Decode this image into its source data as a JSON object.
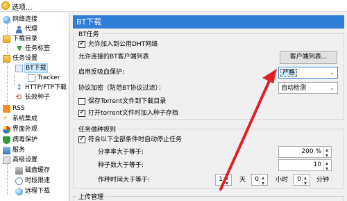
{
  "window": {
    "title": "选项..."
  },
  "sidebar": {
    "items": [
      {
        "label": "网络连接",
        "icon": "globe-icon"
      },
      {
        "label": "代理",
        "icon": "user-icon"
      },
      {
        "label": "下载目录",
        "icon": "folder-icon"
      },
      {
        "label": "任务标签",
        "icon": "arrow-down-icon"
      },
      {
        "label": "任务设置",
        "icon": "folder-icon"
      },
      {
        "label": "BT下载",
        "icon": "bt-icon"
      },
      {
        "label": "Tracker",
        "icon": "document-icon"
      },
      {
        "label": "HTTP/FTP下载",
        "icon": "arrows-icon"
      },
      {
        "label": "长效种子",
        "icon": "refresh-icon"
      },
      {
        "label": "RSS",
        "icon": "rss-icon"
      },
      {
        "label": "系统集成",
        "icon": "plug-icon"
      },
      {
        "label": "界面外观",
        "icon": "palette-icon"
      },
      {
        "label": "病毒保护",
        "icon": "shield-icon"
      },
      {
        "label": "服务",
        "icon": "services-icon"
      },
      {
        "label": "高级设置",
        "icon": "advanced-icon"
      },
      {
        "label": "磁盘缓存",
        "icon": "disk-icon"
      },
      {
        "label": "时段限速",
        "icon": "clock-icon"
      },
      {
        "label": "远程下载",
        "icon": "remote-icon"
      }
    ],
    "selected": "BT下载"
  },
  "main": {
    "header": "BT下载",
    "bt_task": {
      "title": "BT任务",
      "dht_label": "允许加入到公用DHT网络",
      "dht_checked": true,
      "allowed_clients_label": "允许连接的BT客户端列表",
      "client_list_button": "客户端列表...",
      "anti_leech_label": "启用反吸血保护:",
      "anti_leech_value": "严格",
      "encryption_label": "协议加密（防范BT协议过滤）：",
      "encryption_value": "自动检测",
      "save_torrent_label": "保存Torrent文件到下载目录",
      "save_torrent_checked": false,
      "add_seed_label": "打开torrent文件时加入种子存档",
      "add_seed_checked": true
    },
    "seeding_rules": {
      "title": "任务做种规则",
      "auto_stop_label": "符合以下全部条件时自动停止任务",
      "auto_stop_checked": true,
      "ratio_label": "分享率大于等于:",
      "ratio_value": "200 %",
      "seeds_label": "种子数大于等于:",
      "seeds_value": "10",
      "time_label": "作种时间大于等于:",
      "days_value": "1",
      "days_unit": "天",
      "hours_value": "0",
      "hours_unit": "小时",
      "minutes_value": "0",
      "minutes_unit": "分钟"
    },
    "upload_mgmt": {
      "title": "上传管理"
    }
  },
  "colors": {
    "header_blue": "#2f7ed8",
    "annotation_red": "#e02020"
  }
}
